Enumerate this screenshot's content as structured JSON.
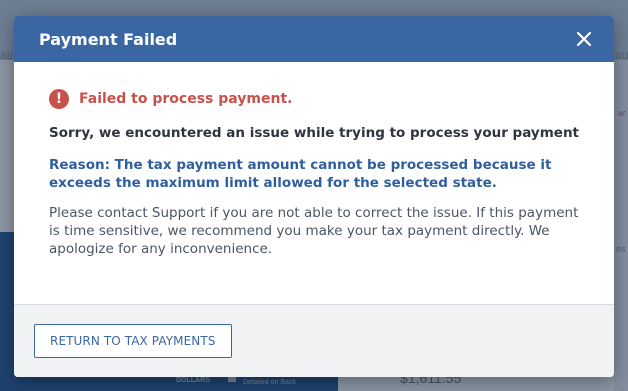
{
  "background": {
    "left_fragment": "ati",
    "right_fragment": "ou",
    "right_fragment2": "w",
    "right_fragment3": "es",
    "dollars": "DOLLARS",
    "detailed": "Detailed on Back",
    "amount": "$1,611.55"
  },
  "modal": {
    "title": "Payment Failed",
    "close_icon": "close-icon",
    "error_icon": "exclamation-circle-icon",
    "error_message": "Failed to process payment.",
    "sorry_message": "Sorry, we encountered an issue while trying to process your payment",
    "reason_message": "Reason: The tax payment amount cannot be processed because it exceeds the maximum limit allowed for the selected state.",
    "info_message": "Please contact Support if you are not able to correct the issue. If this payment is time sensitive, we recommend you make your tax payment directly. We apologize for any inconvenience.",
    "return_button_label": "RETURN TO TAX PAYMENTS"
  },
  "colors": {
    "header_bg": "#3a67a4",
    "error_red": "#c9514b",
    "reason_blue": "#2f5f9e"
  }
}
